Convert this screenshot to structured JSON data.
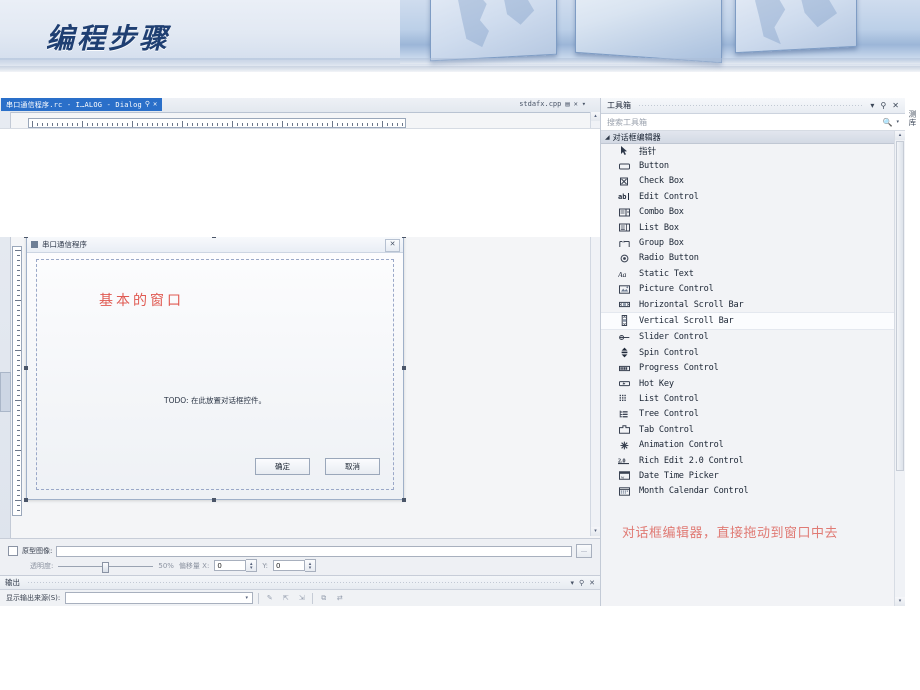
{
  "slide": {
    "title": "编程步骤"
  },
  "editor": {
    "tab_active": "串口通信程序.rc - I…ALOG - Dialog",
    "tab_pin_icon": "pin-icon",
    "tab_close_icon": "close-icon",
    "tab_other": "stdafx.cpp",
    "tab_other_icons": [
      "save-icon",
      "close-icon",
      "chevron-down-icon"
    ]
  },
  "dialog": {
    "title": "串口通信程序",
    "close_glyph": "✕",
    "annotation_red": "基本的窗口",
    "todo": "TODO: 在此放置对话框控件。",
    "ok_label": "确定",
    "cancel_label": "取消"
  },
  "prototype_bar": {
    "checkbox_label": "原型图像:",
    "path_value": "",
    "browse_label": "…",
    "opacity_label": "透明度:",
    "opacity_value": "50%",
    "offset_label": "偏移量 X:",
    "offset_x": "0",
    "offset_y_label": "Y:",
    "offset_y": "0"
  },
  "output": {
    "title": "输出",
    "source_label": "显示输出来源(S):",
    "source_value": "",
    "header_icons": [
      "chevron-down-icon",
      "pin-icon",
      "close-icon"
    ],
    "toolbar_icons": [
      "clear-icon",
      "up-arrow-icon",
      "down-arrow-icon",
      "wrap-icon",
      "goto-icon"
    ]
  },
  "toolbox": {
    "title": "工具箱",
    "header_icons": [
      "chevron-down-icon",
      "pin-icon",
      "close-icon"
    ],
    "search_placeholder": "搜索工具箱",
    "search_icon": "search-icon",
    "search_dropdown_icon": "chevron-down-icon",
    "category": "对话框编辑器",
    "category_icon": "triangle-down-icon",
    "items": [
      {
        "label": "指针",
        "icon": "pointer-icon",
        "cjk": true,
        "selected": false
      },
      {
        "label": "Button",
        "icon": "button-icon",
        "cjk": false,
        "selected": false
      },
      {
        "label": "Check Box",
        "icon": "checkbox-icon",
        "cjk": false,
        "selected": false
      },
      {
        "label": "Edit Control",
        "icon": "edit-control-icon",
        "cjk": false,
        "selected": false
      },
      {
        "label": "Combo Box",
        "icon": "combobox-icon",
        "cjk": false,
        "selected": false
      },
      {
        "label": "List Box",
        "icon": "listbox-icon",
        "cjk": false,
        "selected": false
      },
      {
        "label": "Group Box",
        "icon": "groupbox-icon",
        "cjk": false,
        "selected": false
      },
      {
        "label": "Radio Button",
        "icon": "radio-icon",
        "cjk": false,
        "selected": false
      },
      {
        "label": "Static Text",
        "icon": "static-text-icon",
        "cjk": false,
        "selected": false
      },
      {
        "label": "Picture Control",
        "icon": "picture-icon",
        "cjk": false,
        "selected": false
      },
      {
        "label": "Horizontal Scroll Bar",
        "icon": "hscrollbar-icon",
        "cjk": false,
        "selected": false
      },
      {
        "label": "Vertical Scroll Bar",
        "icon": "vscrollbar-icon",
        "cjk": false,
        "selected": true
      },
      {
        "label": "Slider Control",
        "icon": "slider-icon",
        "cjk": false,
        "selected": false
      },
      {
        "label": "Spin Control",
        "icon": "spin-icon",
        "cjk": false,
        "selected": false
      },
      {
        "label": "Progress Control",
        "icon": "progress-icon",
        "cjk": false,
        "selected": false
      },
      {
        "label": "Hot Key",
        "icon": "hotkey-icon",
        "cjk": false,
        "selected": false
      },
      {
        "label": "List Control",
        "icon": "list-control-icon",
        "cjk": false,
        "selected": false
      },
      {
        "label": "Tree Control",
        "icon": "tree-control-icon",
        "cjk": false,
        "selected": false
      },
      {
        "label": "Tab Control",
        "icon": "tab-control-icon",
        "cjk": false,
        "selected": false
      },
      {
        "label": "Animation Control",
        "icon": "animation-icon",
        "cjk": false,
        "selected": false
      },
      {
        "label": "Rich Edit 2.0 Control",
        "icon": "rich-edit-icon",
        "cjk": false,
        "selected": false
      },
      {
        "label": "Date Time Picker",
        "icon": "date-picker-icon",
        "cjk": false,
        "selected": false
      },
      {
        "label": "Month Calendar Control",
        "icon": "calendar-icon",
        "cjk": false,
        "selected": false
      }
    ]
  },
  "right_rail": {
    "tab_label": "测库"
  },
  "annotation": {
    "text": "对话框编辑器，直接拖动到窗口中去",
    "color": "#e07a74"
  },
  "colors": {
    "accent_tab": "#2a6fc9",
    "banner_title": "#1f3f72",
    "annotation_red": "#e07a74",
    "dialog_red": "#e05a52"
  }
}
